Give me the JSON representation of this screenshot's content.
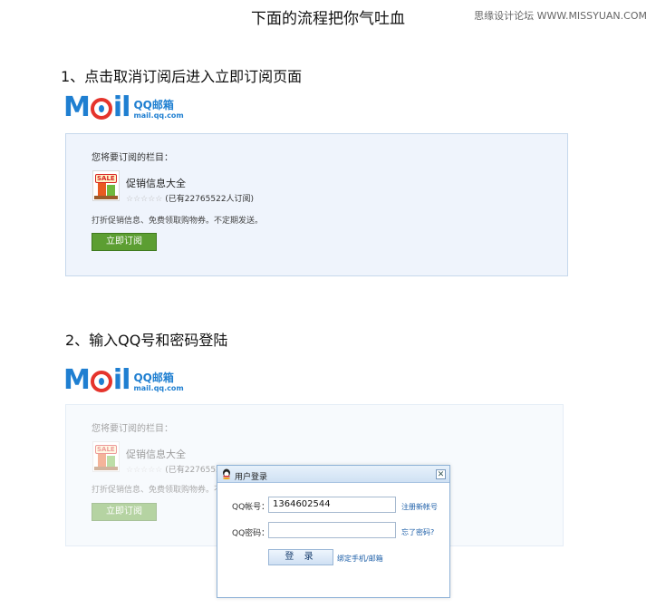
{
  "page_title": "下面的流程把你气吐血",
  "watermark": "思缘设计论坛 WWW.MISSYUAN.COM",
  "steps": [
    {
      "label": "1、点击取消订阅后进入立即订阅页面"
    },
    {
      "label": "2、输入QQ号和密码登陆"
    }
  ],
  "logo": {
    "qq": "QQ邮箱",
    "domain": "mail.qq.com"
  },
  "subscribe_panel": {
    "heading": "您将要订阅的栏目：",
    "icon_tag": "SALE",
    "item_name": "促销信息大全",
    "stars": "☆☆☆☆☆",
    "subscriber_count": "(已有22765522人订阅)",
    "description": "打折促销信息、免费领取购物券。不定期发送。",
    "subscribe_button": "立即订阅"
  },
  "faded_panel": {
    "subscriber_count_partial": "(已有22765522"
  },
  "login_dialog": {
    "title": "用户登录",
    "close_symbol": "✕",
    "account_label": "QQ帐号：",
    "account_value": "1364602544",
    "register_link": "注册新帐号",
    "password_label": "QQ密码：",
    "password_value": "",
    "forgot_link": "忘了密码?",
    "login_button": "登 录",
    "bind_link": "绑定手机/邮箱"
  },
  "colors": {
    "logo_blue": "#1f7fd1",
    "logo_red": "#e5342c",
    "subscribe_green": "#5c9e32",
    "panel_bg": "#eff4fc",
    "link_blue": "#1d5fa8"
  }
}
